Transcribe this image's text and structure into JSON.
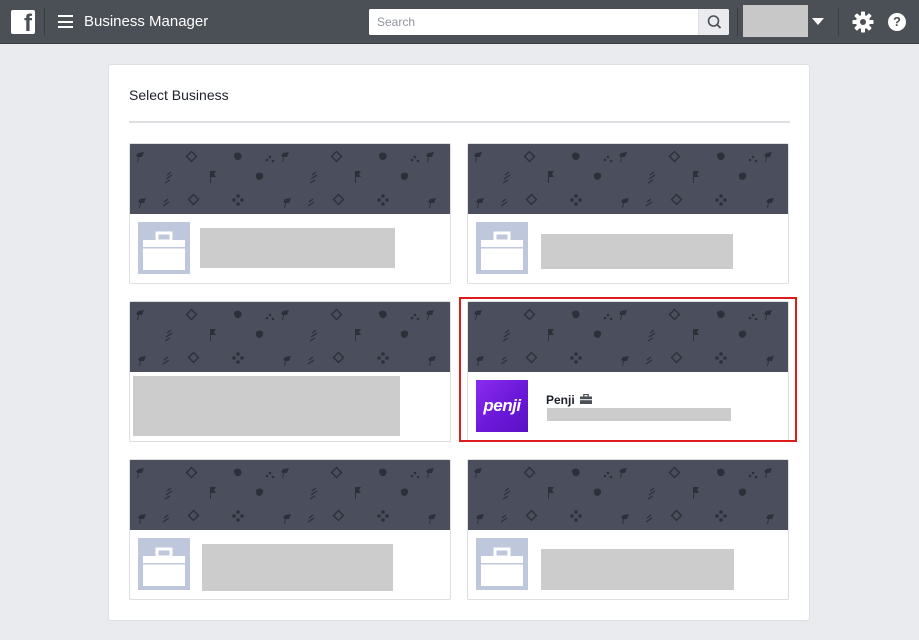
{
  "topbar": {
    "app_title": "Business Manager",
    "search": {
      "placeholder": "Search",
      "value": ""
    },
    "icons": [
      "facebook-logo",
      "menu-icon",
      "search-icon",
      "caret-down-icon",
      "gear-icon",
      "help-icon"
    ],
    "help_glyph": "?"
  },
  "page": {
    "title": "Select Business"
  },
  "businesses": [
    {
      "position": "row-1-left",
      "name": "",
      "redacted": true,
      "thumbnail": "briefcase-placeholder"
    },
    {
      "position": "row-1-right",
      "name": "",
      "redacted": true,
      "thumbnail": "briefcase-placeholder"
    },
    {
      "position": "row-2-left",
      "name": "",
      "redacted": true,
      "thumbnail": "none"
    },
    {
      "position": "row-2-right",
      "name": "Penji",
      "logo_text": "penji",
      "redacted_subtitle": true,
      "selected": true,
      "badge_icon": "briefcase-icon"
    },
    {
      "position": "row-3-left",
      "name": "",
      "redacted": true,
      "thumbnail": "briefcase-placeholder"
    },
    {
      "position": "row-3-right",
      "name": "",
      "redacted": true,
      "thumbnail": "briefcase-placeholder"
    }
  ],
  "colors": {
    "topbar": "#4b4f56",
    "background": "#e9ebee",
    "cover": "#4b4f5d",
    "selection": "#dd1c1c",
    "penji_brand": "#7a1fe6",
    "redaction": "#cccccc"
  }
}
